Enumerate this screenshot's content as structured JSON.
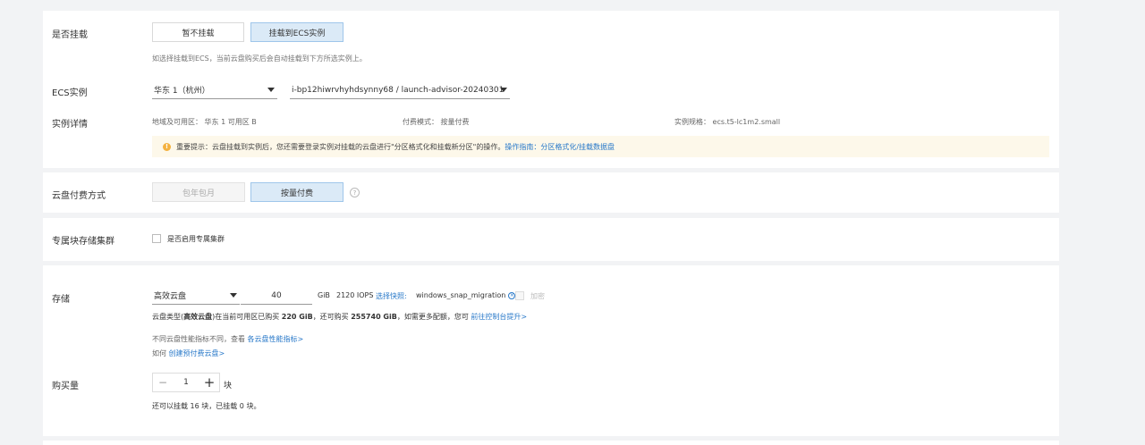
{
  "mount": {
    "label": "是否挂载",
    "option_no": "暂不挂载",
    "option_yes": "挂载到ECS实例",
    "hint": "如选择挂载到ECS，当前云盘购买后会自动挂载到下方所选实例上。"
  },
  "ecs": {
    "label": "ECS实例",
    "region": "华东 1（杭州）",
    "instance": "i-bp12hiwrvhyhdsynny68 / launch-advisor-20240301"
  },
  "details": {
    "label": "实例详情",
    "zone": "地域及可用区：  华东 1 可用区 B",
    "billing": "付费模式：  按量付费",
    "spec": "实例规格：  ecs.t5-lc1m2.small",
    "notice_text": "重要提示：云盘挂载到实例后，您还需要登录实例对挂载的云盘进行\"分区格式化和挂载新分区\"的操作。",
    "notice_link": "操作指南：分区格式化/挂载数据盘"
  },
  "payment": {
    "label": "云盘付费方式",
    "option_sub": "包年包月",
    "option_payg": "按量付费",
    "help": "?"
  },
  "dedicated": {
    "label": "专属块存储集群",
    "checkbox_label": "是否启用专属集群"
  },
  "storage": {
    "label": "存储",
    "disk_type": "高效云盘",
    "size": "40",
    "unit": "GiB",
    "iops": "2120 IOPS",
    "snapshot_label": "选择快照:",
    "snapshot_value": "windows_snap_migration",
    "encrypt_label": "加密",
    "quota_prefix": "云盘类型(",
    "quota_type": "高效云盘",
    "quota_mid1": ")在当前可用区已购买 ",
    "quota_bought": "220 GiB",
    "quota_mid2": "，还可购买 ",
    "quota_left": "255740 GiB",
    "quota_mid3": "，如需更多配额，您可 ",
    "quota_link": "前往控制台提升>",
    "perf_text": "不同云盘性能指标不同，查看 ",
    "perf_link": "各云盘性能指标>",
    "prepaid_text": "如何 ",
    "prepaid_link": "创建预付费云盘>"
  },
  "quantity": {
    "label": "购买量",
    "minus": "−",
    "value": "1",
    "plus": "+",
    "unit": "块",
    "hint": "还可以挂载 16 块，已挂载 0 块。"
  }
}
